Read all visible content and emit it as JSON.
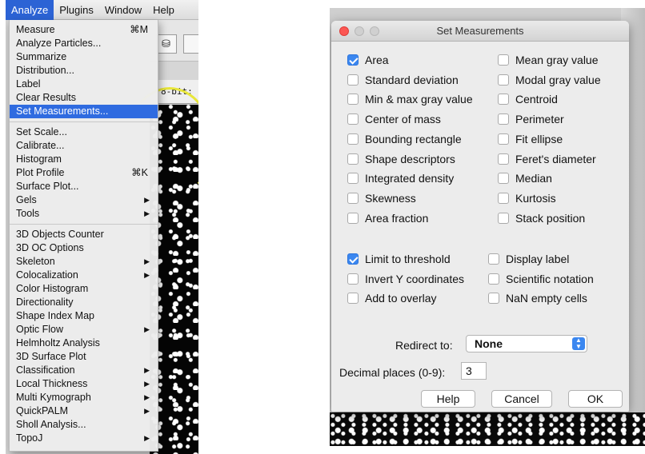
{
  "menubar": {
    "items": [
      "Analyze",
      "Plugins",
      "Window",
      "Help"
    ],
    "active": "Analyze"
  },
  "background_window": {
    "status_text": "8-bit; 75"
  },
  "analyze_menu": {
    "items": [
      {
        "label": "Measure",
        "shortcut": "⌘M"
      },
      {
        "label": "Analyze Particles..."
      },
      {
        "label": "Summarize"
      },
      {
        "label": "Distribution..."
      },
      {
        "label": "Label"
      },
      {
        "label": "Clear Results"
      },
      {
        "label": "Set Measurements...",
        "highlighted": true
      },
      {
        "separator": true
      },
      {
        "label": "Set Scale..."
      },
      {
        "label": "Calibrate..."
      },
      {
        "label": "Histogram"
      },
      {
        "label": "Plot Profile",
        "shortcut": "⌘K"
      },
      {
        "label": "Surface Plot..."
      },
      {
        "label": "Gels",
        "submenu": true
      },
      {
        "label": "Tools",
        "submenu": true
      },
      {
        "separator": true
      },
      {
        "label": "3D Objects Counter"
      },
      {
        "label": "3D OC Options"
      },
      {
        "label": "Skeleton",
        "submenu": true
      },
      {
        "label": "Colocalization",
        "submenu": true
      },
      {
        "label": "Color Histogram"
      },
      {
        "label": "Directionality"
      },
      {
        "label": "Shape Index Map"
      },
      {
        "label": "Optic Flow",
        "submenu": true
      },
      {
        "label": "Helmholtz Analysis"
      },
      {
        "label": "3D Surface Plot"
      },
      {
        "label": "Classification",
        "submenu": true
      },
      {
        "label": "Local Thickness",
        "submenu": true
      },
      {
        "label": "Multi Kymograph",
        "submenu": true
      },
      {
        "label": "QuickPALM",
        "submenu": true
      },
      {
        "label": "Sholl Analysis..."
      },
      {
        "label": "TopoJ",
        "submenu": true
      }
    ]
  },
  "dialog": {
    "title": "Set Measurements",
    "measurements": {
      "left": [
        {
          "label": "Area",
          "checked": true
        },
        {
          "label": "Standard deviation",
          "checked": false
        },
        {
          "label": "Min & max gray value",
          "checked": false
        },
        {
          "label": "Center of mass",
          "checked": false
        },
        {
          "label": "Bounding rectangle",
          "checked": false
        },
        {
          "label": "Shape descriptors",
          "checked": false
        },
        {
          "label": "Integrated density",
          "checked": false
        },
        {
          "label": "Skewness",
          "checked": false
        },
        {
          "label": "Area fraction",
          "checked": false
        }
      ],
      "right": [
        {
          "label": "Mean gray value",
          "checked": false
        },
        {
          "label": "Modal gray value",
          "checked": false
        },
        {
          "label": "Centroid",
          "checked": false
        },
        {
          "label": "Perimeter",
          "checked": false
        },
        {
          "label": "Fit ellipse",
          "checked": false
        },
        {
          "label": "Feret's diameter",
          "checked": false
        },
        {
          "label": "Median",
          "checked": false
        },
        {
          "label": "Kurtosis",
          "checked": false
        },
        {
          "label": "Stack position",
          "checked": false
        }
      ]
    },
    "options": {
      "left": [
        {
          "label": "Limit to threshold",
          "checked": true
        },
        {
          "label": "Invert Y coordinates",
          "checked": false
        },
        {
          "label": "Add to overlay",
          "checked": false
        }
      ],
      "right": [
        {
          "label": "Display label",
          "checked": false
        },
        {
          "label": "Scientific notation",
          "checked": false
        },
        {
          "label": "NaN empty cells",
          "checked": false
        }
      ]
    },
    "redirect_label": "Redirect to:",
    "redirect_value": "None",
    "decimal_label": "Decimal places (0-9):",
    "decimal_value": "3",
    "buttons": {
      "help": "Help",
      "cancel": "Cancel",
      "ok": "OK"
    }
  },
  "colors": {
    "menu_highlight": "#2f6be0",
    "checkbox_checked": "#3b87f0",
    "close_button": "#fc5753"
  }
}
